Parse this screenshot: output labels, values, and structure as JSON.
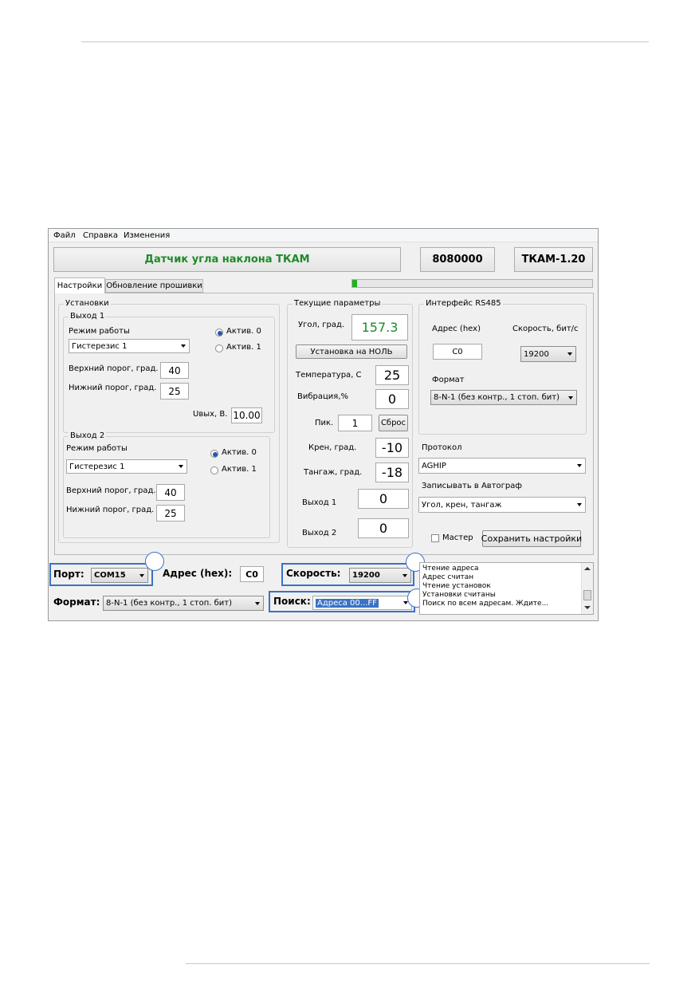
{
  "menu": [
    "Файл",
    "Справка",
    "Изменения"
  ],
  "header": {
    "title": "Датчик угла наклона ТКАМ",
    "serial": "8080000",
    "version": "ТКАМ-1.20"
  },
  "tabs": [
    "Настройки",
    "Обновление прошивки"
  ],
  "progress": {
    "fraction": 0.02,
    "color": "#22b022"
  },
  "settings": {
    "title": "Установки",
    "out1": {
      "title": "Выход 1",
      "mode_label": "Режим работы",
      "mode_value": "Гистерезис 1",
      "active0": "Актив. 0",
      "active1": "Актив. 1",
      "upper_label": "Верхний порог, град.",
      "upper_value": "40",
      "lower_label": "Нижний порог, град.",
      "lower_value": "25",
      "uout_label": "Uвых, В.",
      "uout_value": "10.00"
    },
    "out2": {
      "title": "Выход 2",
      "mode_label": "Режим работы",
      "mode_value": "Гистерезис 1",
      "active0": "Актив. 0",
      "active1": "Актив. 1",
      "upper_label": "Верхний порог, град.",
      "upper_value": "40",
      "lower_label": "Нижний порог, град.",
      "lower_value": "25"
    }
  },
  "current": {
    "title": "Текущие параметры",
    "angle_label": "Угол, град.",
    "angle_value": "157.3",
    "angle_color": "#1a8a2a",
    "zero_button": "Установка на НОЛЬ",
    "temp_label": "Температура, С",
    "temp_value": "25",
    "vib_label": "Вибрация,%",
    "vib_value": "0",
    "peak_label": "Пик.",
    "peak_value": "1",
    "reset_button": "Сброс",
    "roll_label": "Крен, град.",
    "roll_value": "-10",
    "pitch_label": "Тангаж, град.",
    "pitch_value": "-18",
    "out1_label": "Выход 1",
    "out1_value": "0",
    "out2_label": "Выход 2",
    "out2_value": "0"
  },
  "rs485": {
    "title": "Интерфейс RS485",
    "addr_label": "Адрес (hex)",
    "addr_value": "C0",
    "speed_label": "Скорость, бит/с",
    "speed_value": "19200",
    "format_label": "Формат",
    "format_value": "8-N-1 (без контр., 1 стоп. бит)"
  },
  "protocol": {
    "label": "Протокол",
    "value": "AGHIP"
  },
  "record": {
    "label": "Записывать в Автограф",
    "value": "Угол, крен, тангаж"
  },
  "master_label": "Мастер",
  "save_button": "Сохранить настройки",
  "bottom": {
    "port_label": "Порт:",
    "port_value": "COM15",
    "addr_label": "Адрес (hex):",
    "addr_value": "C0",
    "speed_label": "Скорость:",
    "speed_value": "19200",
    "format_label": "Формат:",
    "format_value": "8-N-1 (без контр., 1 стоп. бит)",
    "search_label": "Поиск:",
    "search_value": "Адреса 00...FF"
  },
  "log": [
    "Чтение адреса",
    "Адрес считан",
    "Чтение установок",
    "Установки считаны",
    "Поиск по всем адресам. Ждите..."
  ]
}
